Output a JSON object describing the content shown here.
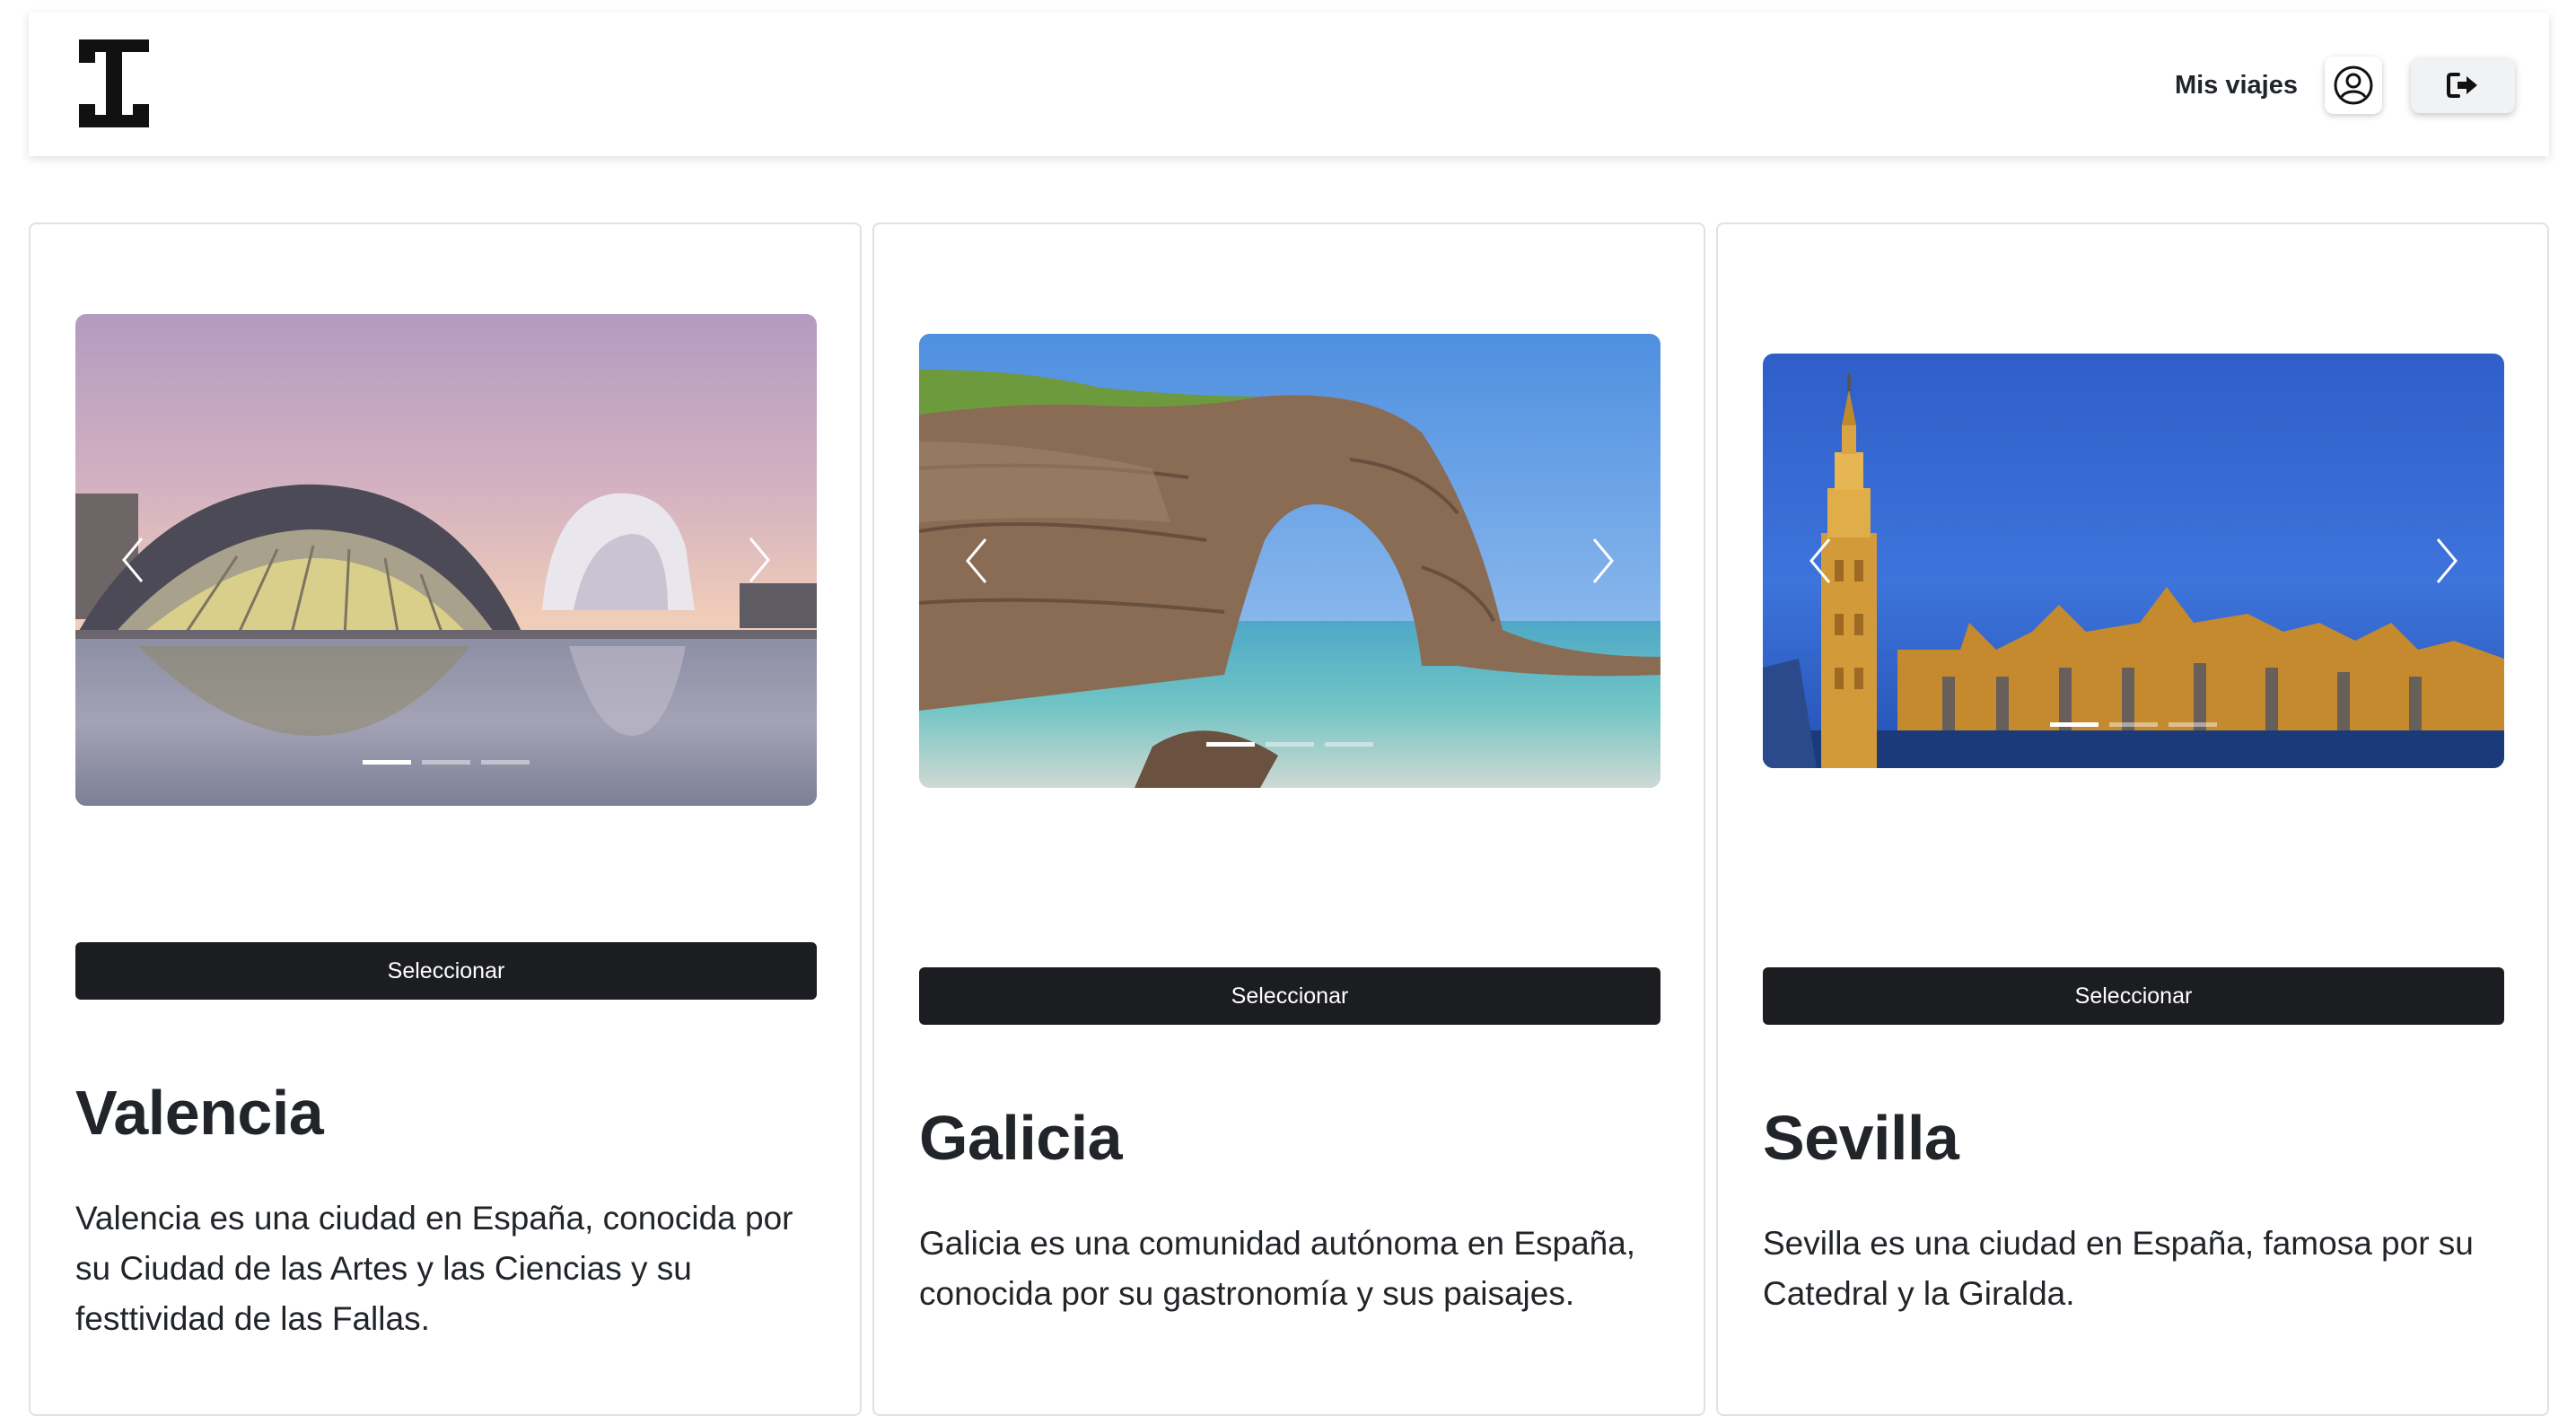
{
  "header": {
    "logo_icon": "brand-logo",
    "nav_link": "Mis viajes",
    "user_icon": "user-circle-icon",
    "logout_icon": "sign-out-icon"
  },
  "cards": [
    {
      "title": "Valencia",
      "description": "Valencia es una ciudad en España, conocida por su Ciudad de las Artes y las Ciencias y su festtividad de las Fallas.",
      "button_label": "Seleccionar",
      "slides": 3,
      "active_slide": 1
    },
    {
      "title": "Galicia",
      "description": "Galicia es una comunidad autónoma en España, conocida por su gastronomía y sus paisajes.",
      "button_label": "Seleccionar",
      "slides": 3,
      "active_slide": 1
    },
    {
      "title": "Sevilla",
      "description": "Sevilla es una ciudad en España, famosa por su Catedral y la Giralda.",
      "button_label": "Seleccionar",
      "slides": 3,
      "active_slide": 1
    }
  ],
  "colors": {
    "button_bg": "#1c1d20",
    "text": "#212529",
    "card_border": "#dee2e6"
  }
}
